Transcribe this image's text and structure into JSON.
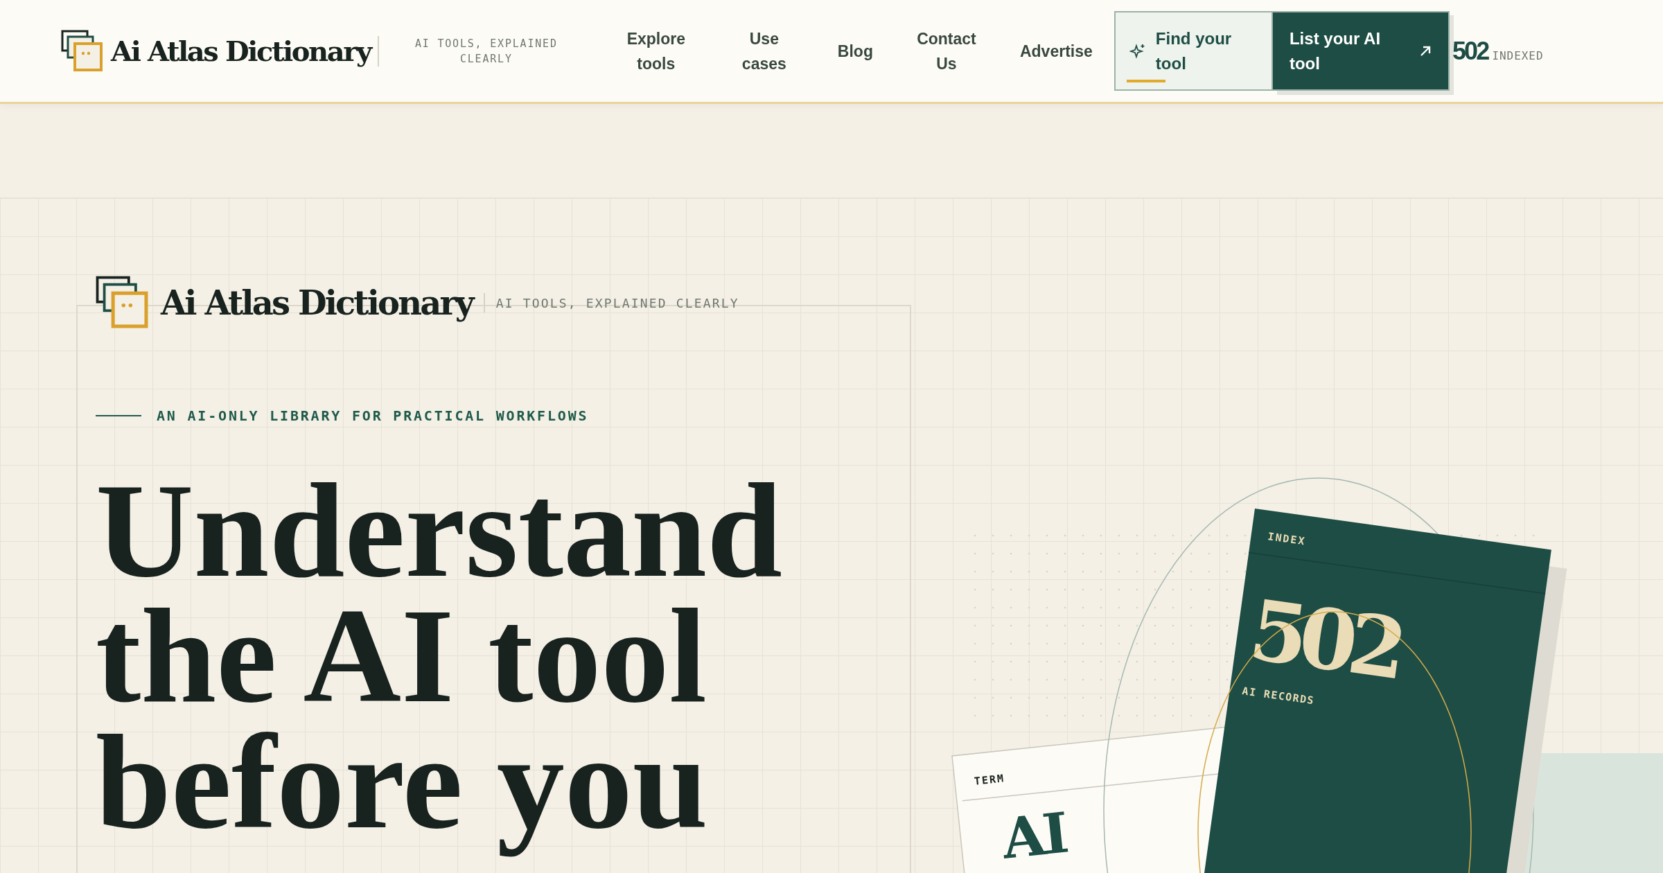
{
  "header": {
    "logo": {
      "name": "Ai Atlas Dictionary"
    },
    "tagline": "AI TOOLS, EXPLAINED CLEARLY",
    "nav": [
      {
        "label": "Explore tools"
      },
      {
        "label": "Use cases"
      },
      {
        "label": "Blog"
      },
      {
        "label": "Contact Us"
      },
      {
        "label": "Advertise"
      }
    ],
    "find_button": {
      "label": "Find your tool"
    },
    "list_button": {
      "label": "List your AI tool"
    },
    "counter": {
      "value": "502",
      "label": "INDEXED"
    }
  },
  "hero": {
    "brand": {
      "name": "Ai Atlas Dictionary",
      "tagline": "AI TOOLS, EXPLAINED CLEARLY"
    },
    "eyebrow": "AN AI-ONLY LIBRARY FOR PRACTICAL WORKFLOWS",
    "headline": [
      "Understand",
      "the AI tool",
      "before you"
    ],
    "index_card": {
      "label": "INDEX",
      "number": "502",
      "caption": "AI RECORDS"
    },
    "term_card": {
      "label": "TERM",
      "term": "AI"
    }
  }
}
